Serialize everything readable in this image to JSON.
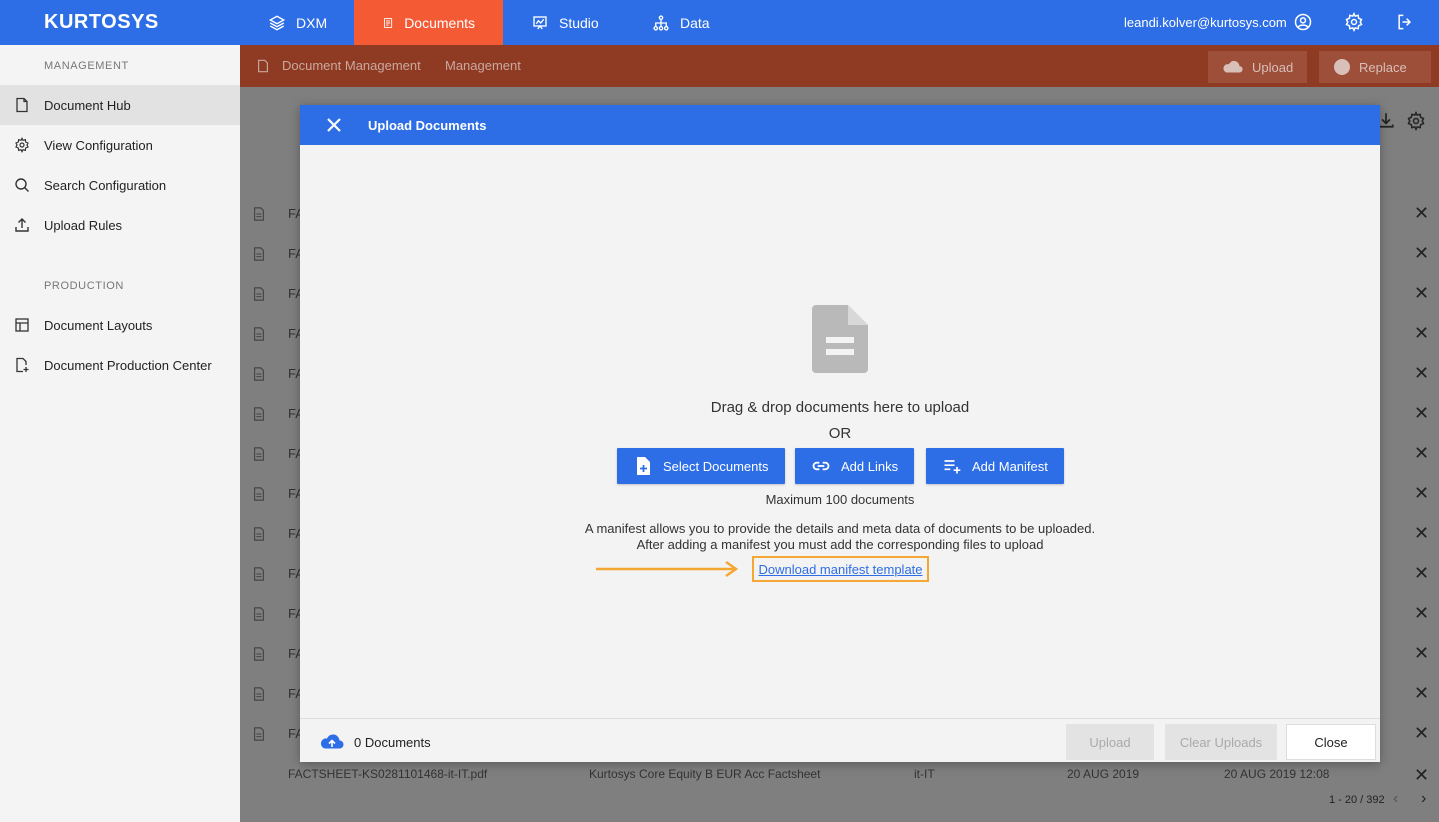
{
  "brand": {
    "logo": "KURTOSYS",
    "primary": "#2d6ee6",
    "accent": "#f45a34"
  },
  "topnav": {
    "tabs": [
      {
        "label": "DXM",
        "icon": "layers-icon",
        "active": false
      },
      {
        "label": "Documents",
        "icon": "document-icon",
        "active": true
      },
      {
        "label": "Studio",
        "icon": "presentation-icon",
        "active": false
      },
      {
        "label": "Data",
        "icon": "hierarchy-icon",
        "active": false
      }
    ],
    "user_email": "leandi.kolver@kurtosys.com"
  },
  "sidebar": {
    "sections": [
      {
        "title": "MANAGEMENT",
        "items": [
          {
            "label": "Document Hub",
            "icon": "document-icon",
            "active": true
          },
          {
            "label": "View Configuration",
            "icon": "gear-icon",
            "active": false
          },
          {
            "label": "Search Configuration",
            "icon": "search-icon",
            "active": false
          },
          {
            "label": "Upload Rules",
            "icon": "upload-icon",
            "active": false
          }
        ]
      },
      {
        "title": "PRODUCTION",
        "items": [
          {
            "label": "Document Layouts",
            "icon": "layout-icon",
            "active": false
          },
          {
            "label": "Document Production Center",
            "icon": "document-add-icon",
            "active": false
          }
        ]
      }
    ]
  },
  "background": {
    "breadcrumb": [
      "Document Management",
      "Management"
    ],
    "upload_label": "Upload",
    "replace_label": "Replace",
    "row_prefix": "FA",
    "last_row": {
      "filename": "FACTSHEET-KS0281101468-it-IT.pdf",
      "title": "Kurtosys Core Equity B EUR Acc Factsheet",
      "locale": "it-IT",
      "date1": "20 AUG 2019",
      "date2": "20 AUG 2019 12:08"
    },
    "pager": "1 - 20 / 392"
  },
  "modal": {
    "title": "Upload Documents",
    "drop_text": "Drag & drop documents here to upload",
    "or_text": "OR",
    "buttons": {
      "select": "Select Documents",
      "links": "Add Links",
      "manifest": "Add Manifest"
    },
    "max_text": "Maximum 100 documents",
    "manifest_line1": "A manifest allows you to provide the details and meta data of documents to be uploaded.",
    "manifest_line2": "After adding a manifest you must add the corresponding files to upload",
    "download_link": "Download manifest template",
    "footer": {
      "count": "0 Documents",
      "upload": "Upload",
      "clear": "Clear Uploads",
      "close": "Close"
    }
  }
}
